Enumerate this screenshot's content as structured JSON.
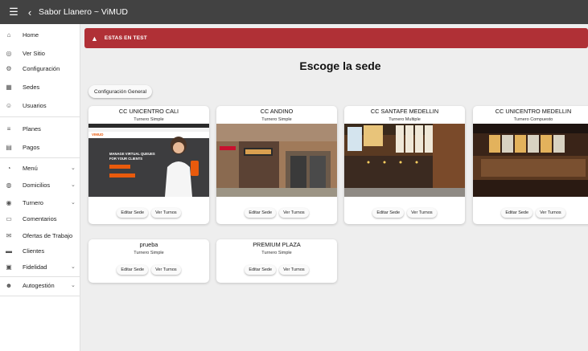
{
  "topbar": {
    "title": "Sabor Llanero ~ ViMUD",
    "menu_icon": "☰",
    "back_icon": "‹"
  },
  "sidebar": {
    "items": [
      {
        "label": "Home",
        "icon": "home-icon",
        "glyph": "⌂",
        "expandable": false
      },
      {
        "label": "Ver Sitio",
        "icon": "globe-icon",
        "glyph": "◎",
        "expandable": false
      },
      {
        "label": "Configuración",
        "icon": "gear-icon",
        "glyph": "⚙",
        "expandable": false
      },
      {
        "label": "Sedes",
        "icon": "store-icon",
        "glyph": "▦",
        "expandable": false
      },
      {
        "label": "Usuarios",
        "icon": "users-icon",
        "glyph": "☺",
        "expandable": false
      },
      {
        "label": "Planes",
        "icon": "plans-icon",
        "glyph": "≡",
        "expandable": false
      },
      {
        "label": "Pagos",
        "icon": "payments-icon",
        "glyph": "▤",
        "expandable": false
      },
      {
        "label": "Menú",
        "icon": "menu-book-icon",
        "glyph": "◔",
        "expandable": true
      },
      {
        "label": "Domicilios",
        "icon": "delivery-icon",
        "glyph": "◍",
        "expandable": true
      },
      {
        "label": "Turnero",
        "icon": "ticket-icon",
        "glyph": "◉",
        "expandable": true
      },
      {
        "label": "Comentarios",
        "icon": "comment-icon",
        "glyph": "▭",
        "expandable": false
      },
      {
        "label": "Ofertas de Trabajo",
        "icon": "job-offer-icon",
        "glyph": "✉",
        "expandable": false
      },
      {
        "label": "Clientes",
        "icon": "clients-icon",
        "glyph": "▬",
        "expandable": false
      },
      {
        "label": "Fidelidad",
        "icon": "loyalty-icon",
        "glyph": "▣",
        "expandable": true
      },
      {
        "label": "Autogestión",
        "icon": "self-service-icon",
        "glyph": "☻",
        "expandable": true
      }
    ]
  },
  "alert": {
    "text": "ESTAS EN TEST",
    "icon": "warning-icon",
    "color": "#b03036"
  },
  "main": {
    "title": "Escoge la sede",
    "config_button": "Configuración General",
    "edit_label": "Editar Sede",
    "turns_label": "Ver Turnos",
    "promo": {
      "brand": "VIMUD",
      "headline1": "MANAGE VIRTUAL QUEUES",
      "headline2": "FOR YOUR CLIENTS"
    },
    "cards": [
      {
        "name": "CC UNICENTRO CALI",
        "type": "Turnero Simple",
        "image": "promo"
      },
      {
        "name": "CC ANDINO",
        "type": "Turnero Simple",
        "image": "andino"
      },
      {
        "name": "CC SANTAFE MEDELLIN",
        "type": "Turnero Multiple",
        "image": "santafe"
      },
      {
        "name": "CC UNICENTRO MEDELLIN",
        "type": "Turnero Compuesto",
        "image": "unicentro"
      },
      {
        "name": "prueba",
        "type": "Turnero Simple",
        "image": ""
      },
      {
        "name": "PREMIUM PLAZA",
        "type": "Turnero Simple",
        "image": ""
      }
    ]
  }
}
